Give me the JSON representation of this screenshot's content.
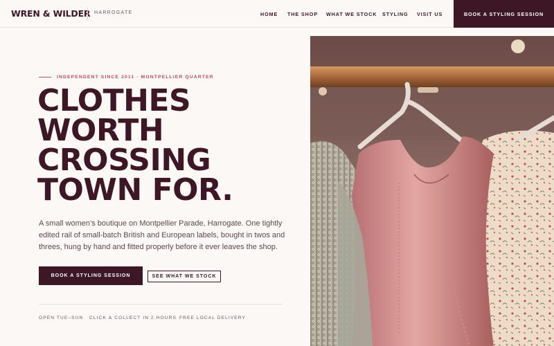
{
  "brand": {
    "logo": "WREN & WILDER",
    "location": "HARROGATE"
  },
  "nav": {
    "items": [
      {
        "label": "HOME"
      },
      {
        "label": "THE SHOP"
      },
      {
        "label": "WHAT WE STOCK"
      },
      {
        "label": "STYLING"
      },
      {
        "label": "VISIT US"
      }
    ],
    "cta": "BOOK A STYLING SESSION"
  },
  "hero": {
    "eyebrow": "INDEPENDENT SINCE 2011 · MONTPELLIER QUARTER",
    "headline": [
      "CLOTHES",
      "WORTH",
      "CROSSING",
      "TOWN FOR."
    ],
    "lede": "A small women’s boutique on Montpellier Parade, Harrogate. One tightly edited rail of small-batch British and European labels, bought in twos and threes, hung by hand and fitted properly before it ever leaves the shop.",
    "primary_cta": "BOOK A STYLING SESSION",
    "secondary_cta": "SEE WHAT WE STOCK",
    "features": [
      "OPEN TUE–SUN",
      "CLICK & COLLECT IN 2 HOURS",
      "FREE LOCAL DELIVERY"
    ]
  },
  "colors": {
    "brand": "#3d1726",
    "accent": "#b94a63",
    "background": "#fcf8f6"
  }
}
